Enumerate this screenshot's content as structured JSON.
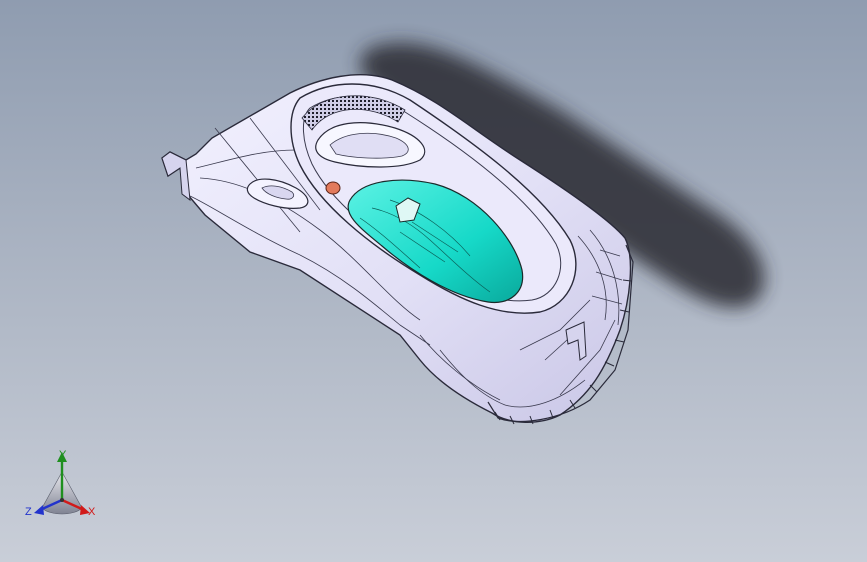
{
  "viewport": {
    "background_top": "#8f9cb0",
    "background_bottom": "#c9ced8"
  },
  "model": {
    "body_color": "#e6e4f8",
    "edge_color": "#2a2a3a",
    "insert_color": "#19e0cf",
    "button_color": "#e27a5c",
    "shadow_color": "#2c2c30"
  },
  "triad": {
    "x_label": "X",
    "y_label": "Y",
    "z_label": "Z",
    "x_color": "#d11a1a",
    "y_color": "#1f8f1f",
    "z_color": "#2233cc"
  }
}
